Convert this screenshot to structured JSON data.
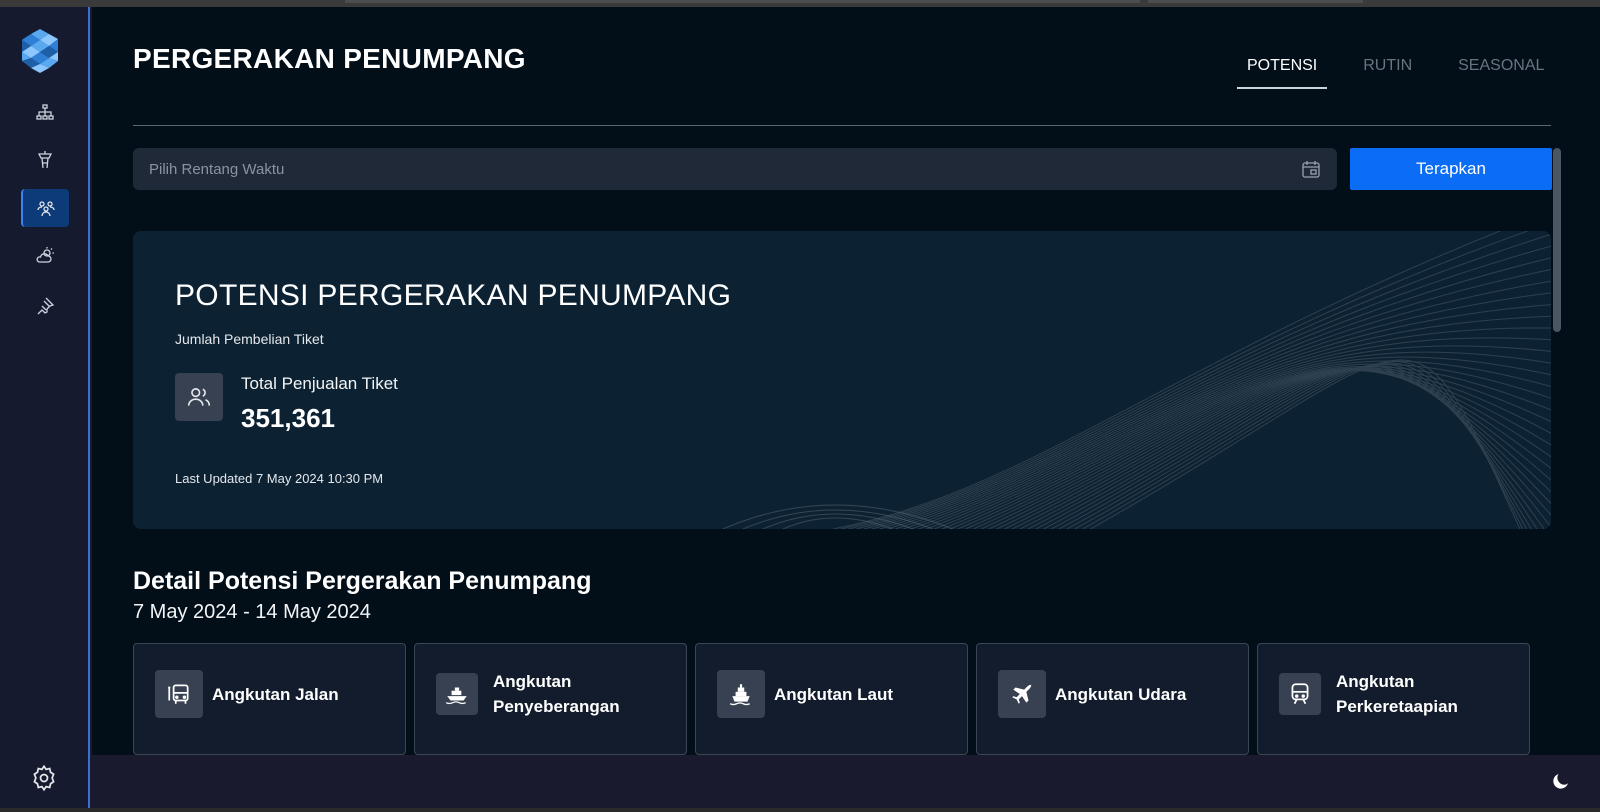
{
  "header": {
    "title": "PERGERAKAN PENUMPANG",
    "tabs": [
      {
        "label": "POTENSI",
        "active": true
      },
      {
        "label": "RUTIN",
        "active": false
      },
      {
        "label": "SEASONAL",
        "active": false
      }
    ]
  },
  "filter": {
    "date_placeholder": "Pilih Rentang Waktu",
    "date_value": "",
    "apply_label": "Terapkan"
  },
  "hero": {
    "title": "POTENSI PERGERAKAN PENUMPANG",
    "subtitle": "Jumlah Pembelian Tiket",
    "stat_label": "Total Penjualan Tiket",
    "stat_value": "351,361",
    "last_updated": "Last Updated 7 May 2024 10:30 PM"
  },
  "detail": {
    "title": "Detail Potensi Pergerakan Penumpang",
    "range": "7 May 2024 - 14 May 2024",
    "cards": [
      {
        "label": "Angkutan Jalan",
        "icon": "bus-icon"
      },
      {
        "label": "Angkutan Penyeberangan",
        "icon": "ferry-icon"
      },
      {
        "label": "Angkutan Laut",
        "icon": "ship-icon"
      },
      {
        "label": "Angkutan Udara",
        "icon": "airplane-icon"
      },
      {
        "label": "Angkutan Perkeretaapian",
        "icon": "train-icon"
      }
    ]
  },
  "sidebar": {
    "items": [
      {
        "icon": "network-icon",
        "active": false
      },
      {
        "icon": "control-tower-icon",
        "active": false
      },
      {
        "icon": "passengers-icon",
        "active": true
      },
      {
        "icon": "weather-icon",
        "active": false
      },
      {
        "icon": "pin-icon",
        "active": false
      }
    ]
  },
  "colors": {
    "accent": "#0b6cf5",
    "main_bg": "#020f19",
    "sidebar_bg": "#161a2e",
    "hero_bg": "#0c2233"
  }
}
